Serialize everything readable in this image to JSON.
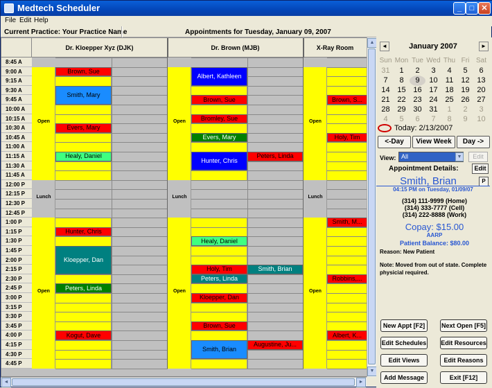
{
  "window": {
    "title": "Medtech Scheduler"
  },
  "menu": {
    "file": "File",
    "edit": "Edit",
    "help": "Help"
  },
  "infobar": {
    "practice": "Current Practice: Your Practice Name",
    "date": "Appointments for Tuesday, January 09, 2007"
  },
  "columns": [
    {
      "title": "Dr. Kloepper Xyz (DJK)"
    },
    {
      "title": "Dr. Brown (MJB)"
    },
    {
      "title": "X-Ray Room"
    }
  ],
  "times": [
    "8:45 A",
    "9:00 A",
    "9:15 A",
    "9:30 A",
    "9:45 A",
    "10:00 A",
    "10:15 A",
    "10:30 A",
    "10:45 A",
    "11:00 A",
    "11:15 A",
    "11:30 A",
    "11:45 A",
    "12:00 P",
    "12:15 P",
    "12:30 P",
    "12:45 P",
    "1:00 P",
    "1:15 P",
    "1:30 P",
    "1:45 P",
    "2:00 P",
    "2:15 P",
    "2:30 P",
    "2:45 P",
    "3:00 P",
    "3:15 P",
    "3:30 P",
    "3:45 P",
    "4:00 P",
    "4:15 P",
    "4:30 P",
    "4:45 P"
  ],
  "status_labels": {
    "open": "Open",
    "lunch": "Lunch"
  },
  "appointments": [
    {
      "col": 0,
      "sub": 0,
      "start": 1,
      "len": 1,
      "name": "Brown, Sue",
      "color": "#ff0000"
    },
    {
      "col": 0,
      "sub": 0,
      "start": 3,
      "len": 2,
      "name": "Smith, Mary",
      "color": "#1a8cff"
    },
    {
      "col": 0,
      "sub": 0,
      "start": 7,
      "len": 1,
      "name": "Evers, Mary",
      "color": "#ff0000"
    },
    {
      "col": 0,
      "sub": 0,
      "start": 10,
      "len": 1,
      "name": "Healy, Daniel",
      "color": "#40ff80"
    },
    {
      "col": 0,
      "sub": 0,
      "start": 18,
      "len": 1,
      "name": "Hunter, Chris",
      "color": "#ff0000"
    },
    {
      "col": 0,
      "sub": 0,
      "start": 20,
      "len": 3,
      "name": "Kloepper, Dan",
      "color": "#008080"
    },
    {
      "col": 0,
      "sub": 0,
      "start": 24,
      "len": 1,
      "name": "Peters, Linda",
      "color": "#008000"
    },
    {
      "col": 0,
      "sub": 0,
      "start": 29,
      "len": 1,
      "name": "Kogut, Dave",
      "color": "#ff0000"
    },
    {
      "col": 1,
      "sub": 0,
      "start": 1,
      "len": 2,
      "name": "Albert, Kathleen",
      "color": "#0000ff"
    },
    {
      "col": 1,
      "sub": 0,
      "start": 4,
      "len": 1,
      "name": "Brown, Sue",
      "color": "#ff0000"
    },
    {
      "col": 1,
      "sub": 0,
      "start": 6,
      "len": 1,
      "name": "Bromley, Sue",
      "color": "#ff0000"
    },
    {
      "col": 1,
      "sub": 0,
      "start": 8,
      "len": 1,
      "name": "Evers, Mary",
      "color": "#008000"
    },
    {
      "col": 1,
      "sub": 0,
      "start": 10,
      "len": 2,
      "name": "Hunter, Chris",
      "color": "#0000ff"
    },
    {
      "col": 1,
      "sub": 1,
      "start": 10,
      "len": 1,
      "name": "Peters, Linda",
      "color": "#ff0000"
    },
    {
      "col": 1,
      "sub": 0,
      "start": 19,
      "len": 1,
      "name": "Healy, Daniel",
      "color": "#40ff80"
    },
    {
      "col": 1,
      "sub": 0,
      "start": 22,
      "len": 1,
      "name": "Holy, Tim",
      "color": "#ff0000"
    },
    {
      "col": 1,
      "sub": 1,
      "start": 22,
      "len": 1,
      "name": "Smith, Brian",
      "color": "#008080"
    },
    {
      "col": 1,
      "sub": 0,
      "start": 23,
      "len": 1,
      "name": "Peters, Linda",
      "color": "#008080"
    },
    {
      "col": 1,
      "sub": 0,
      "start": 25,
      "len": 1,
      "name": "Kloepper, Dan",
      "color": "#ff0000"
    },
    {
      "col": 1,
      "sub": 0,
      "start": 28,
      "len": 1,
      "name": "Brown, Sue",
      "color": "#ff0000"
    },
    {
      "col": 1,
      "sub": 0,
      "start": 30,
      "len": 2,
      "name": "Smith, Brian",
      "color": "#1a8cff"
    },
    {
      "col": 1,
      "sub": 1,
      "start": 30,
      "len": 1,
      "name": "Augustine, Ju...",
      "color": "#ff0000"
    },
    {
      "col": 2,
      "sub": 0,
      "start": 4,
      "len": 1,
      "name": "Brown, S...",
      "color": "#ff0000"
    },
    {
      "col": 2,
      "sub": 0,
      "start": 8,
      "len": 1,
      "name": "Holy, Tim",
      "color": "#ff0000"
    },
    {
      "col": 2,
      "sub": 0,
      "start": 17,
      "len": 1,
      "name": "Smith, M...",
      "color": "#ff0000"
    },
    {
      "col": 2,
      "sub": 0,
      "start": 23,
      "len": 1,
      "name": "Robbins,...",
      "color": "#ff0000"
    },
    {
      "col": 2,
      "sub": 0,
      "start": 29,
      "len": 1,
      "name": "Albert, K...",
      "color": "#ff0000"
    }
  ],
  "calendar": {
    "title": "January 2007",
    "prev": "◄",
    "next": "►",
    "dows": [
      "Sun",
      "Mon",
      "Tue",
      "Wed",
      "Thu",
      "Fri",
      "Sat"
    ],
    "weeks": [
      [
        "31",
        "1",
        "2",
        "3",
        "4",
        "5",
        "6"
      ],
      [
        "7",
        "8",
        "9",
        "10",
        "11",
        "12",
        "13"
      ],
      [
        "14",
        "15",
        "16",
        "17",
        "18",
        "19",
        "20"
      ],
      [
        "21",
        "22",
        "23",
        "24",
        "25",
        "26",
        "27"
      ],
      [
        "28",
        "29",
        "30",
        "31",
        "1",
        "2",
        "3"
      ],
      [
        "4",
        "5",
        "6",
        "7",
        "8",
        "9",
        "10"
      ]
    ],
    "selected": "9",
    "today": "Today: 2/13/2007"
  },
  "nav": {
    "prev_day": "<-Day",
    "view_week": "View Week",
    "next_day": "Day ->"
  },
  "view": {
    "label": "View:",
    "value": "All",
    "edit": "Edit"
  },
  "details": {
    "label": "Appointment Details:",
    "edit": "Edit",
    "patient": "Smith, Brian",
    "p_button": "P",
    "when": "04:15 PM on Tuesday, 01/09/07",
    "home": "(314) 111-9999 (Home)",
    "cell": "(314) 333-7777 (Cell)",
    "work": "(314) 222-8888 (Work)",
    "copay": "Copay: $15.00",
    "insurance": "AARP",
    "balance": "Patient Balance: $80.00",
    "reason": "Reason: New Patient",
    "note": "Note: Moved from out of state. Complete physicial required."
  },
  "actions": {
    "new_appt": "New Appt [F2]",
    "next_open": "Next Open [F5]",
    "edit_schedules": "Edit Schedules",
    "edit_resources": "Edit Resources",
    "edit_views": "Edit Views",
    "edit_reasons": "Edit Reasons",
    "add_message": "Add Message",
    "exit": "Exit [F12]"
  }
}
